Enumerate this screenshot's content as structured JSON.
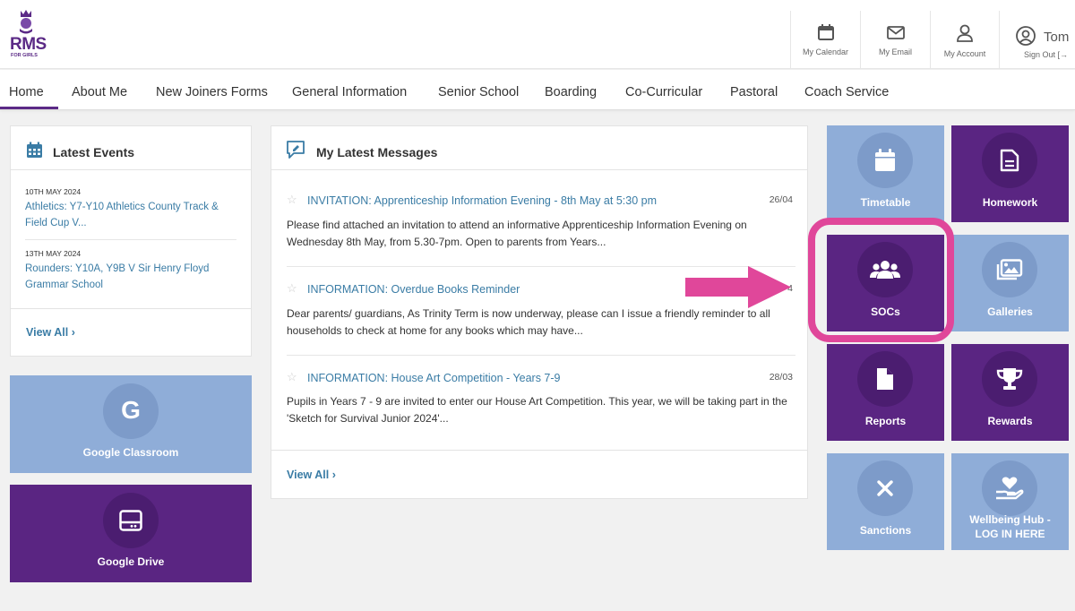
{
  "brand": {
    "logo_text": "RMS",
    "logo_sub": "FOR GIRLS",
    "purple": "#5b2a86",
    "link_blue": "#3a7ca5",
    "tile_light": "#8fadd8",
    "tile_dark": "#5a2582",
    "highlight_pink": "#e0479a"
  },
  "header": {
    "calendar_label": "My Calendar",
    "email_label": "My Email",
    "account_label": "My Account",
    "user_name": "Tom",
    "signout_label": "Sign Out"
  },
  "nav": {
    "items": [
      "Home",
      "About Me",
      "New Joiners Forms",
      "General Information",
      "Senior School",
      "Boarding",
      "Co-Curricular",
      "Pastoral",
      "Coach Service"
    ],
    "active": "Home"
  },
  "events": {
    "title": "Latest Events",
    "items": [
      {
        "date": "10TH MAY 2024",
        "title": "Athletics: Y7-Y10 Athletics County Track & Field Cup V..."
      },
      {
        "date": "13TH MAY 2024",
        "title": "Rounders: Y10A, Y9B V Sir Henry Floyd Grammar School"
      }
    ],
    "view_all": "View All"
  },
  "google": {
    "classroom_label": "Google Classroom",
    "classroom_glyph": "G",
    "drive_label": "Google Drive"
  },
  "messages": {
    "title": "My Latest Messages",
    "items": [
      {
        "title": "INVITATION: Apprenticeship Information Evening - 8th May at 5:30 pm",
        "date": "26/04",
        "body": "Please find attached an invitation to attend an informative Apprenticeship Information Evening on Wednesday 8th May, from 5.30-7pm. Open to parents from Years..."
      },
      {
        "title": "INFORMATION: Overdue Books Reminder",
        "date": "4",
        "body": "Dear parents/ guardians, As Trinity Term is now underway, please can I issue a friendly reminder to all households to check at home for any books which may have..."
      },
      {
        "title": "INFORMATION: House Art Competition - Years 7-9",
        "date": "28/03",
        "body": "Pupils in Years 7 - 9 are invited to enter our House Art Competition.   This year, we will be taking part in the 'Sketch for Survival Junior 2024'..."
      }
    ],
    "view_all": "View All"
  },
  "tiles": {
    "timetable": "Timetable",
    "homework": "Homework",
    "socs": "SOCs",
    "galleries": "Galleries",
    "reports": "Reports",
    "rewards": "Rewards",
    "sanctions": "Sanctions",
    "wellbeing_line1": "Wellbeing Hub -",
    "wellbeing_line2": "LOG IN HERE"
  }
}
